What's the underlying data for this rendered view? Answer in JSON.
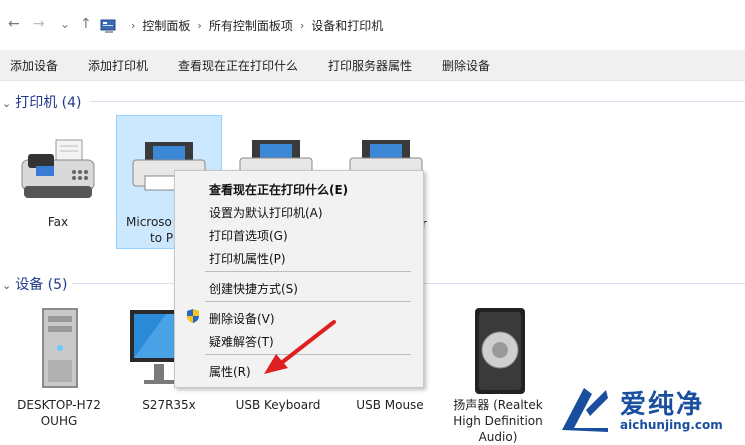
{
  "address": {
    "breadcrumbs": [
      "控制面板",
      "所有控制面板项",
      "设备和打印机"
    ],
    "nav": {
      "back": "←",
      "forward": "→",
      "recent": "⌄",
      "up": "↑"
    }
  },
  "commands": [
    "添加设备",
    "添加打印机",
    "查看现在正在打印什么",
    "打印服务器属性",
    "删除设备"
  ],
  "printers_group": {
    "label": "打印机 (4)"
  },
  "devices_group": {
    "label": "设备 (5)"
  },
  "printers": [
    {
      "label_line1": "Fax",
      "label_line2": ""
    },
    {
      "label_line1": "Microso",
      "label_line2": "to P"
    },
    {
      "label_line1": "",
      "label_line2": ""
    },
    {
      "label_line1": "r",
      "label_line2": ""
    }
  ],
  "devices": [
    {
      "label_line1": "DESKTOP-H72",
      "label_line2": "OUHG",
      "label_line3": ""
    },
    {
      "label_line1": "S27R35x",
      "label_line2": "",
      "label_line3": ""
    },
    {
      "label_line1": "USB Keyboard",
      "label_line2": "",
      "label_line3": ""
    },
    {
      "label_line1": "USB Mouse",
      "label_line2": "",
      "label_line3": ""
    },
    {
      "label_line1": "扬声器 (Realtek",
      "label_line2": "High Definition",
      "label_line3": "Audio)"
    }
  ],
  "context_menu": {
    "items": [
      "查看现在正在打印什么(E)",
      "设置为默认打印机(A)",
      "打印首选项(G)",
      "打印机属性(P)",
      "创建快捷方式(S)",
      "删除设备(V)",
      "疑难解答(T)",
      "属性(R)"
    ]
  },
  "watermark": {
    "title": "爱纯净",
    "url": "aichunjing.com"
  },
  "colors": {
    "selection": "#cce8ff",
    "annotation_arrow": "#e02020",
    "group_header": "#1e3a8a",
    "watermark": "#1a4fa0"
  }
}
